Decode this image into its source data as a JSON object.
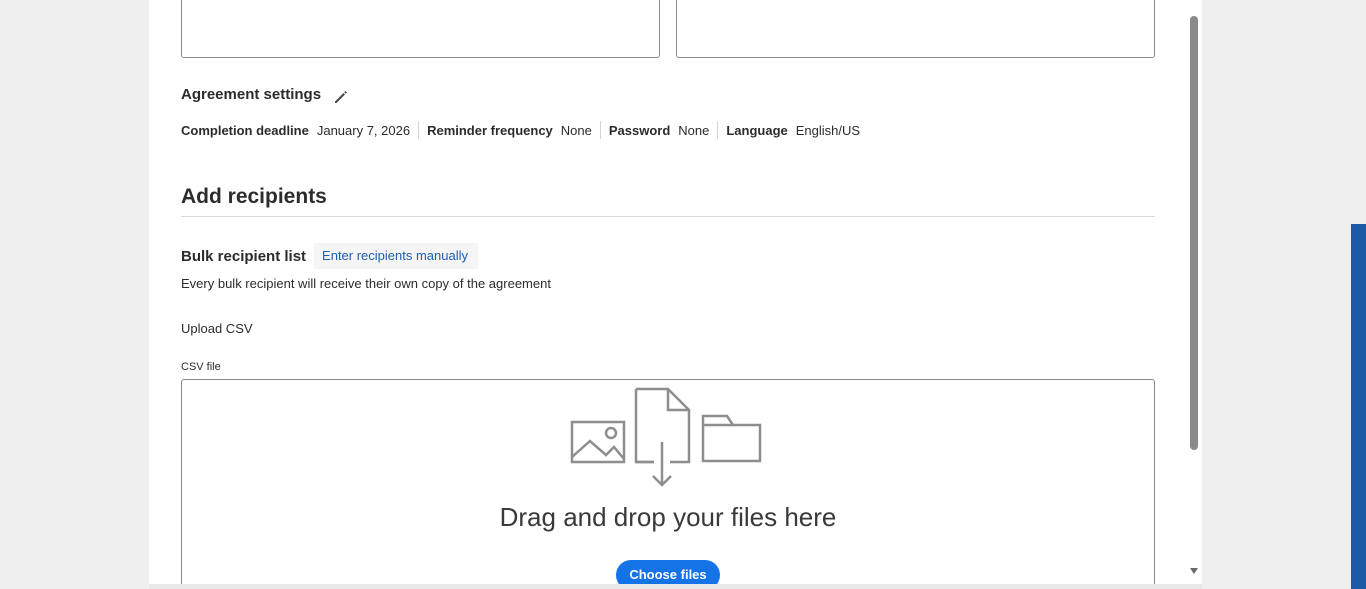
{
  "agreement_settings": {
    "title": "Agreement settings",
    "edit_icon": "pencil-icon",
    "items": [
      {
        "key": "Completion deadline",
        "value": "January 7, 2026"
      },
      {
        "key": "Reminder frequency",
        "value": "None"
      },
      {
        "key": "Password",
        "value": "None"
      },
      {
        "key": "Language",
        "value": "English/US"
      }
    ]
  },
  "recipients": {
    "title": "Add recipients",
    "tabs": {
      "active": "Bulk recipient list",
      "link": "Enter recipients manually"
    },
    "description": "Every bulk recipient will receive their own copy of the agreement",
    "upload_label": "Upload CSV",
    "csv_label": "CSV file",
    "dropzone": {
      "icons": [
        "image-icon",
        "document-download-icon",
        "folder-icon"
      ],
      "text": "Drag and drop your files here",
      "button": "Choose files"
    }
  },
  "colors": {
    "accent": "#1473e6",
    "link": "#1b5fb3",
    "side_bar": "#1d5aa6"
  }
}
